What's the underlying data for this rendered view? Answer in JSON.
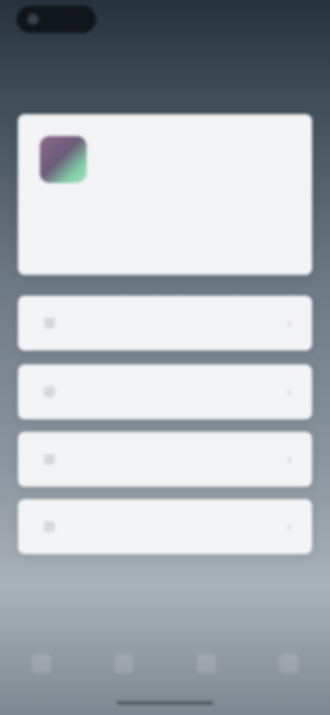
{
  "status_bar": {
    "text": ""
  },
  "header": {
    "title": ""
  },
  "app_card": {
    "name": "",
    "subtitle": "",
    "line1": "",
    "line2": ""
  },
  "rows": [
    {
      "label": "",
      "value": ""
    },
    {
      "label": "",
      "value": ""
    },
    {
      "label": "",
      "value": ""
    },
    {
      "label": "",
      "value": ""
    }
  ]
}
